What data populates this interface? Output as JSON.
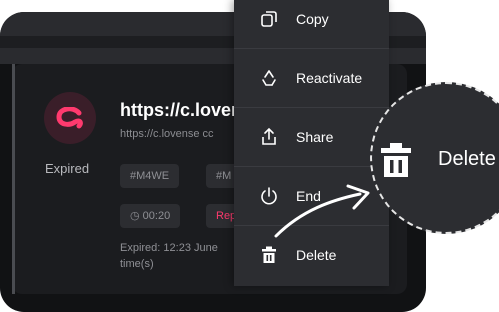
{
  "card": {
    "url_title": "https://c.loven",
    "url_sub": "https://c.lovense cc",
    "status": "Expired",
    "chips": [
      "#M4WE",
      "#M"
    ],
    "timer": "00:20",
    "repeat_chip": "Rep",
    "expired_text": "Expired: 12:23 June time(s)"
  },
  "menu": {
    "items": [
      {
        "label": "Copy",
        "icon": "copy-icon"
      },
      {
        "label": "Reactivate",
        "icon": "recycle-icon"
      },
      {
        "label": "Share",
        "icon": "share-icon"
      },
      {
        "label": "End",
        "icon": "power-icon"
      },
      {
        "label": "Delete",
        "icon": "trash-icon"
      }
    ]
  },
  "zoom": {
    "label": "Delete",
    "icon": "trash-icon"
  },
  "colors": {
    "accent_pink": "#ff3a6e",
    "background": "#111214",
    "menu_bg": "#2c2d31"
  }
}
